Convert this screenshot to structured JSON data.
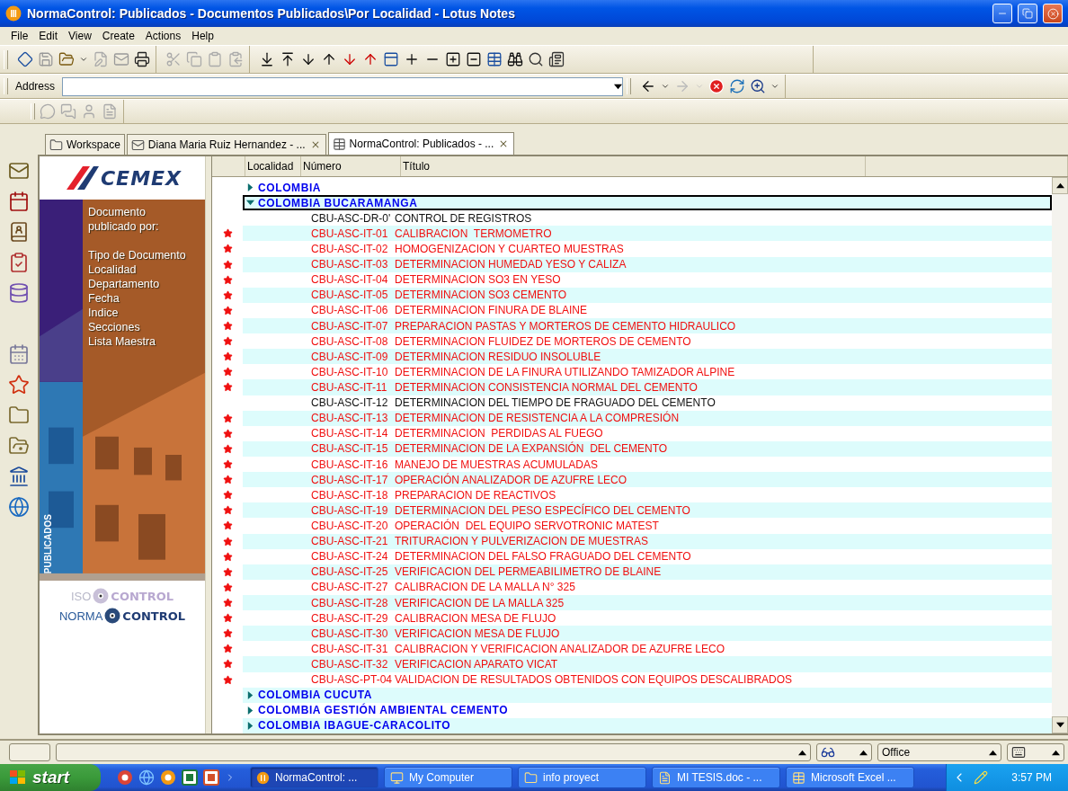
{
  "window": {
    "title": "NormaControl: Publicados - Documentos Publicados\\Por Localidad - Lotus Notes"
  },
  "menu": [
    "File",
    "Edit",
    "View",
    "Create",
    "Actions",
    "Help"
  ],
  "address_bar": {
    "label": "Address"
  },
  "tabs": [
    {
      "label": "Workspace",
      "selected": false,
      "closable": false
    },
    {
      "label": "Diana Maria Ruiz Hernandez - ...",
      "selected": false,
      "closable": true
    },
    {
      "label": "NormaControl: Publicados - ...",
      "selected": true,
      "closable": true
    }
  ],
  "banner": {
    "logo": "CEMEX",
    "heading": "Documento publicado por:",
    "links": [
      "Tipo de Documento",
      "Localidad",
      "Departamento",
      "Fecha",
      "Indice",
      "Secciones",
      "Lista Maestra"
    ],
    "side_label": "PUBLICADOS",
    "iso_logo": [
      "ISO",
      "CONTROL"
    ],
    "norma_logo": [
      "NORMA",
      "CONTROL"
    ]
  },
  "view": {
    "columns": [
      "Localidad",
      "Número",
      "Título"
    ],
    "rows": [
      {
        "kind": "category",
        "label": "COLOMBIA",
        "expanded": false,
        "selected": false
      },
      {
        "kind": "category",
        "label": "COLOMBIA BUCARAMANGA",
        "expanded": true,
        "selected": true
      },
      {
        "kind": "document",
        "number": "CBU-ASC-DR-0'",
        "title": "CONTROL DE REGISTROS",
        "starred": false,
        "selected": false
      },
      {
        "kind": "document",
        "number": "CBU-ASC-IT-01",
        "title": "CALIBRACION  TERMOMETRO",
        "starred": true,
        "selected": false
      },
      {
        "kind": "document",
        "number": "CBU-ASC-IT-02",
        "title": "HOMOGENIZACION Y CUARTEO MUESTRAS",
        "starred": true,
        "selected": false
      },
      {
        "kind": "document",
        "number": "CBU-ASC-IT-03",
        "title": "DETERMINACION HUMEDAD YESO Y CALIZA",
        "starred": true,
        "selected": false
      },
      {
        "kind": "document",
        "number": "CBU-ASC-IT-04",
        "title": "DETERMINACION SO3 EN YESO",
        "starred": true,
        "selected": false
      },
      {
        "kind": "document",
        "number": "CBU-ASC-IT-05",
        "title": "DETERMINACION SO3 CEMENTO",
        "starred": true,
        "selected": false
      },
      {
        "kind": "document",
        "number": "CBU-ASC-IT-06",
        "title": "DETERMINACION FINURA DE BLAINE",
        "starred": true,
        "selected": false
      },
      {
        "kind": "document",
        "number": "CBU-ASC-IT-07",
        "title": "PREPARACION PASTAS Y MORTEROS DE CEMENTO HIDRAULICO",
        "starred": true,
        "selected": false
      },
      {
        "kind": "document",
        "number": "CBU-ASC-IT-08",
        "title": "DETERMINACION FLUIDEZ DE MORTEROS DE CEMENTO",
        "starred": true,
        "selected": false
      },
      {
        "kind": "document",
        "number": "CBU-ASC-IT-09",
        "title": "DETERMINACION RESIDUO INSOLUBLE",
        "starred": true,
        "selected": false
      },
      {
        "kind": "document",
        "number": "CBU-ASC-IT-10",
        "title": "DETERMINACION DE LA FINURA UTILIZANDO TAMIZADOR ALPINE",
        "starred": true,
        "selected": false
      },
      {
        "kind": "document",
        "number": "CBU-ASC-IT-11",
        "title": "DETERMINACION CONSISTENCIA NORMAL DEL CEMENTO",
        "starred": true,
        "selected": false
      },
      {
        "kind": "document",
        "number": "CBU-ASC-IT-12",
        "title": "DETERMINACION DEL TIEMPO DE FRAGUADO DEL CEMENTO",
        "starred": false,
        "selected": false
      },
      {
        "kind": "document",
        "number": "CBU-ASC-IT-13",
        "title": "DETERMINACION DE RESISTENCIA A LA COMPRESIÓN",
        "starred": true,
        "selected": false
      },
      {
        "kind": "document",
        "number": "CBU-ASC-IT-14",
        "title": "DETERMINACION  PERDIDAS AL FUEGO",
        "starred": true,
        "selected": false
      },
      {
        "kind": "document",
        "number": "CBU-ASC-IT-15",
        "title": "DETERMINACION DE LA EXPANSIÓN  DEL CEMENTO",
        "starred": true,
        "selected": false
      },
      {
        "kind": "document",
        "number": "CBU-ASC-IT-16",
        "title": "MANEJO DE MUESTRAS ACUMULADAS",
        "starred": true,
        "selected": false
      },
      {
        "kind": "document",
        "number": "CBU-ASC-IT-17",
        "title": "OPERACIÓN ANALIZADOR DE AZUFRE LECO",
        "starred": true,
        "selected": false
      },
      {
        "kind": "document",
        "number": "CBU-ASC-IT-18",
        "title": "PREPARACION DE REACTIVOS",
        "starred": true,
        "selected": false
      },
      {
        "kind": "document",
        "number": "CBU-ASC-IT-19",
        "title": "DETERMINACION DEL PESO ESPECÍFICO DEL CEMENTO",
        "starred": true,
        "selected": false
      },
      {
        "kind": "document",
        "number": "CBU-ASC-IT-20",
        "title": "OPERACIÓN  DEL EQUIPO SERVOTRONIC MATEST",
        "starred": true,
        "selected": false
      },
      {
        "kind": "document",
        "number": "CBU-ASC-IT-21",
        "title": "TRITURACION Y PULVERIZACION DE MUESTRAS",
        "starred": true,
        "selected": false
      },
      {
        "kind": "document",
        "number": "CBU-ASC-IT-24",
        "title": "DETERMINACION DEL FALSO FRAGUADO DEL CEMENTO",
        "starred": true,
        "selected": false
      },
      {
        "kind": "document",
        "number": "CBU-ASC-IT-25",
        "title": "VERIFICACION DEL PERMEABILIMETRO DE BLAINE",
        "starred": true,
        "selected": false
      },
      {
        "kind": "document",
        "number": "CBU-ASC-IT-27",
        "title": "CALIBRACION DE LA MALLA N° 325",
        "starred": true,
        "selected": false
      },
      {
        "kind": "document",
        "number": "CBU-ASC-IT-28",
        "title": "VERIFICACION DE LA MALLA 325",
        "starred": true,
        "selected": false
      },
      {
        "kind": "document",
        "number": "CBU-ASC-IT-29",
        "title": "CALIBRACION MESA DE FLUJO",
        "starred": true,
        "selected": false
      },
      {
        "kind": "document",
        "number": "CBU-ASC-IT-30",
        "title": "VERIFICACION MESA DE FLUJO",
        "starred": true,
        "selected": false
      },
      {
        "kind": "document",
        "number": "CBU-ASC-IT-31",
        "title": "CALIBRACION Y VERIFICACION ANALIZADOR DE AZUFRE LECO",
        "starred": true,
        "selected": false
      },
      {
        "kind": "document",
        "number": "CBU-ASC-IT-32",
        "title": "VERIFICACION APARATO VICAT",
        "starred": true,
        "selected": false
      },
      {
        "kind": "document",
        "number": "CBU-ASC-PT-04",
        "title": "VALIDACION DE RESULTADOS OBTENIDOS CON EQUIPOS DESCALIBRADOS",
        "starred": true,
        "selected": false
      },
      {
        "kind": "category",
        "label": "COLOMBIA CUCUTA",
        "expanded": false,
        "selected": false
      },
      {
        "kind": "category",
        "label": "COLOMBIA GESTIÓN AMBIENTAL CEMENTO",
        "expanded": false,
        "selected": false
      },
      {
        "kind": "category",
        "label": "COLOMBIA IBAGUE-CARACOLITO",
        "expanded": false,
        "selected": false
      }
    ]
  },
  "status_bar": {
    "location": "Office"
  },
  "taskbar": {
    "start": "start",
    "tasks": [
      {
        "label": "NormaControl: ...",
        "selected": true
      },
      {
        "label": "My Computer",
        "selected": false
      },
      {
        "label": "info proyect",
        "selected": false
      },
      {
        "label": "MI TESIS.doc - ...",
        "selected": false
      },
      {
        "label": "Microsoft Excel ...",
        "selected": false
      }
    ],
    "clock": "3:57 PM"
  }
}
